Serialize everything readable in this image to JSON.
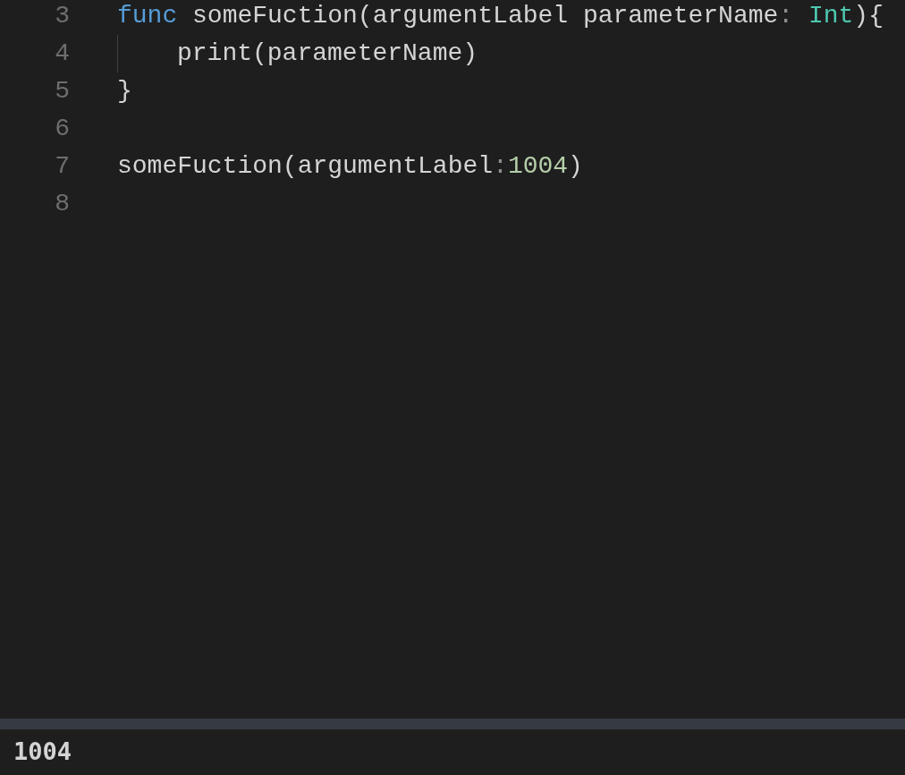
{
  "editor": {
    "lines": [
      {
        "number": "3",
        "indent_guide": false,
        "tokens": [
          {
            "kind": "keyword",
            "text": "func"
          },
          {
            "kind": "plain",
            "text": " someFuction(argumentLabel parameterName"
          },
          {
            "kind": "punct",
            "text": ": "
          },
          {
            "kind": "type",
            "text": "Int"
          },
          {
            "kind": "plain",
            "text": "){"
          }
        ]
      },
      {
        "number": "4",
        "indent_guide": true,
        "tokens": [
          {
            "kind": "plain",
            "text": "print(parameterName)"
          }
        ]
      },
      {
        "number": "5",
        "indent_guide": false,
        "tokens": [
          {
            "kind": "plain",
            "text": "}"
          }
        ]
      },
      {
        "number": "6",
        "indent_guide": false
      },
      {
        "number": "7",
        "indent_guide": false,
        "tokens": [
          {
            "kind": "plain",
            "text": "someFuction(argumentLabel"
          },
          {
            "kind": "punct",
            "text": ":"
          },
          {
            "kind": "number",
            "text": "1004"
          },
          {
            "kind": "plain",
            "text": ")"
          }
        ]
      },
      {
        "number": "8",
        "indent_guide": false
      }
    ]
  },
  "console": {
    "output": "1004"
  }
}
